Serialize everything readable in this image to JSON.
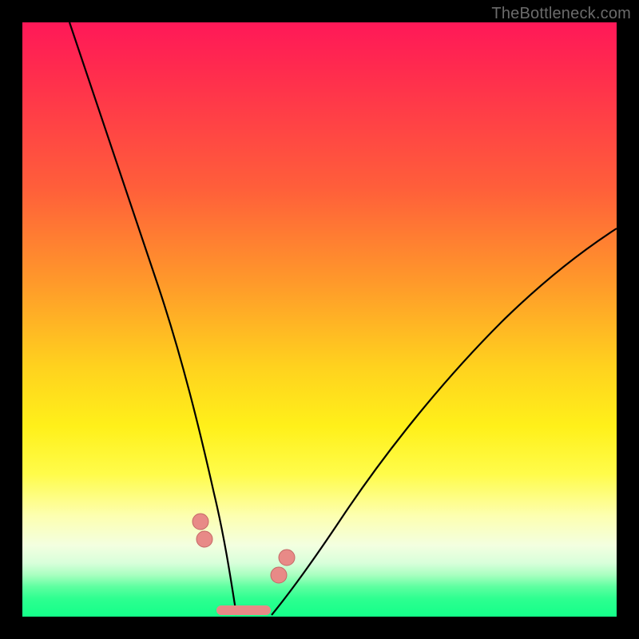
{
  "watermark": "TheBottleneck.com",
  "colors": {
    "gradient_top": "#ff1858",
    "gradient_mid": "#ffd21e",
    "gradient_bottom": "#14ff89",
    "curve": "#000000",
    "marker": "#e88a87",
    "frame": "#000000"
  },
  "chart_data": {
    "type": "line",
    "title": "",
    "xlabel": "",
    "ylabel": "",
    "xlim": [
      0,
      100
    ],
    "ylim": [
      0,
      100
    ],
    "grid": false,
    "legend": false,
    "note": "Axes have no tick labels; values are normalized 0–100 estimates read from pixel positions.",
    "series": [
      {
        "name": "left-curve",
        "x": [
          8,
          12,
          16,
          20,
          24,
          27,
          29,
          31,
          33,
          34.5,
          35.5,
          36
        ],
        "y": [
          100,
          88,
          74,
          58,
          42,
          28,
          18,
          11,
          6,
          3,
          1.5,
          0.3
        ]
      },
      {
        "name": "right-curve",
        "x": [
          42,
          44,
          47,
          52,
          58,
          66,
          76,
          86,
          96,
          100
        ],
        "y": [
          0.3,
          2.5,
          7,
          15,
          24,
          34,
          45,
          54,
          62,
          65
        ]
      }
    ],
    "markers": [
      {
        "name": "left-upper-dot",
        "x": 30.0,
        "y": 16.0,
        "r": 1.4
      },
      {
        "name": "left-lower-dot",
        "x": 30.7,
        "y": 13.0,
        "r": 1.4
      },
      {
        "name": "right-upper-dot",
        "x": 44.5,
        "y": 10.0,
        "r": 1.4
      },
      {
        "name": "right-lower-dot",
        "x": 43.2,
        "y": 7.0,
        "r": 1.4
      },
      {
        "name": "bottom-segment",
        "x1": 33.5,
        "y1": 0.8,
        "x2": 41.0,
        "y2": 0.8
      }
    ]
  }
}
